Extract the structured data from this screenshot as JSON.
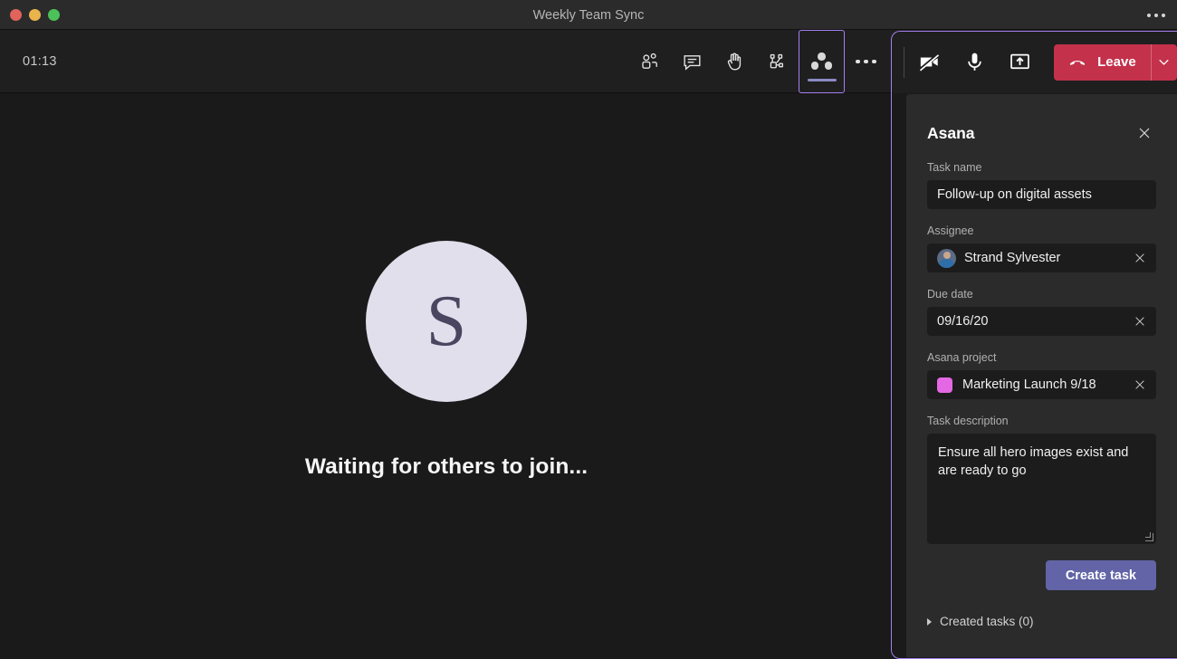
{
  "window": {
    "title": "Weekly Team Sync",
    "more_icon": "ellipsis-icon"
  },
  "toolbar": {
    "timer": "01:13",
    "buttons": [
      {
        "name": "participants",
        "icon": "people-icon",
        "label": "People"
      },
      {
        "name": "chat",
        "icon": "chat-bubble-icon",
        "label": "Chat"
      },
      {
        "name": "raise-hand",
        "icon": "raise-hand-icon",
        "label": "Raise hand"
      },
      {
        "name": "breakout-rooms",
        "icon": "breakout-rooms-icon",
        "label": "Breakout rooms"
      },
      {
        "name": "asana-app",
        "icon": "asana-logo-icon",
        "label": "Asana",
        "active": true
      },
      {
        "name": "more-options",
        "icon": "ellipsis-icon",
        "label": "More options"
      }
    ]
  },
  "call_controls": {
    "camera": {
      "icon": "camera-off-icon",
      "label": "Camera",
      "state": "off"
    },
    "microphone": {
      "icon": "microphone-icon",
      "label": "Microphone",
      "state": "on"
    },
    "share": {
      "icon": "share-screen-icon",
      "label": "Share"
    },
    "leave_label": "Leave",
    "leave_icon": "hangup-icon",
    "leave_caret_icon": "chevron-down-icon",
    "leave_color": "#c4314b"
  },
  "stage": {
    "avatar_initial": "S",
    "avatar_bg": "#e1dfec",
    "avatar_fg": "#4a4660",
    "waiting_text": "Waiting for others to join..."
  },
  "panel": {
    "title": "Asana",
    "close_icon": "close-icon",
    "accent_border": "#a67ef0",
    "fields": {
      "task_name": {
        "label": "Task name",
        "value": "Follow-up on digital assets",
        "placeholder": "Task name"
      },
      "assignee": {
        "label": "Assignee",
        "value": "Strand Sylvester",
        "avatar_icon": "user-avatar-photo",
        "clear_icon": "close-icon"
      },
      "due_date": {
        "label": "Due date",
        "value": "09/16/20",
        "clear_icon": "close-icon"
      },
      "project": {
        "label": "Asana project",
        "value": "Marketing Launch 9/18",
        "swatch_color": "#e368e3",
        "clear_icon": "close-icon"
      },
      "description": {
        "label": "Task description",
        "value": "Ensure all hero images exist and are ready to go",
        "placeholder": "Task description"
      }
    },
    "create_button": {
      "label": "Create task",
      "color": "#6264a7"
    },
    "created_tasks": {
      "label": "Created tasks (0)",
      "count": 0,
      "expanded": false,
      "caret_icon": "caret-right-icon"
    }
  }
}
